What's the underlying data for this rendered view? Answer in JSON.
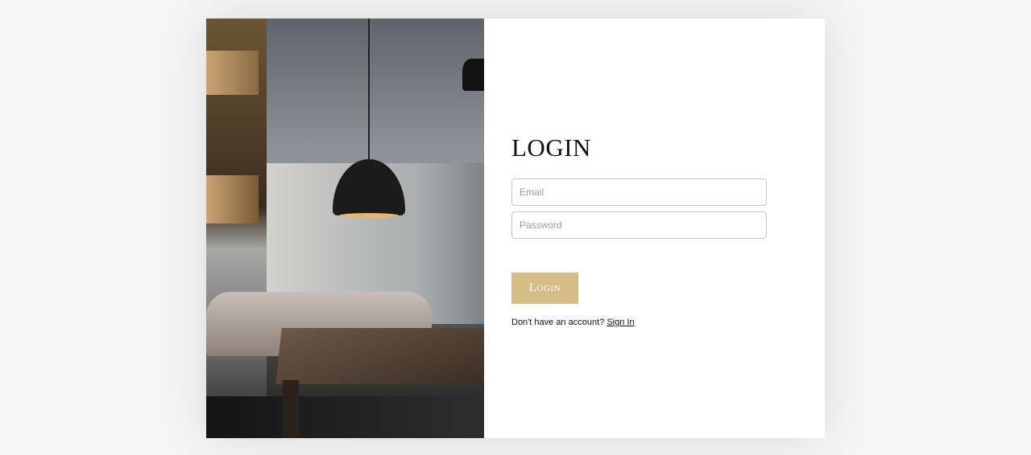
{
  "login": {
    "title": "LOGIN",
    "email_placeholder": "Email",
    "password_placeholder": "Password",
    "submit_label": "Login",
    "signup_prompt": "Don't have an account?",
    "signup_link": "Sign In"
  },
  "colors": {
    "accent": "#d4bd87"
  }
}
